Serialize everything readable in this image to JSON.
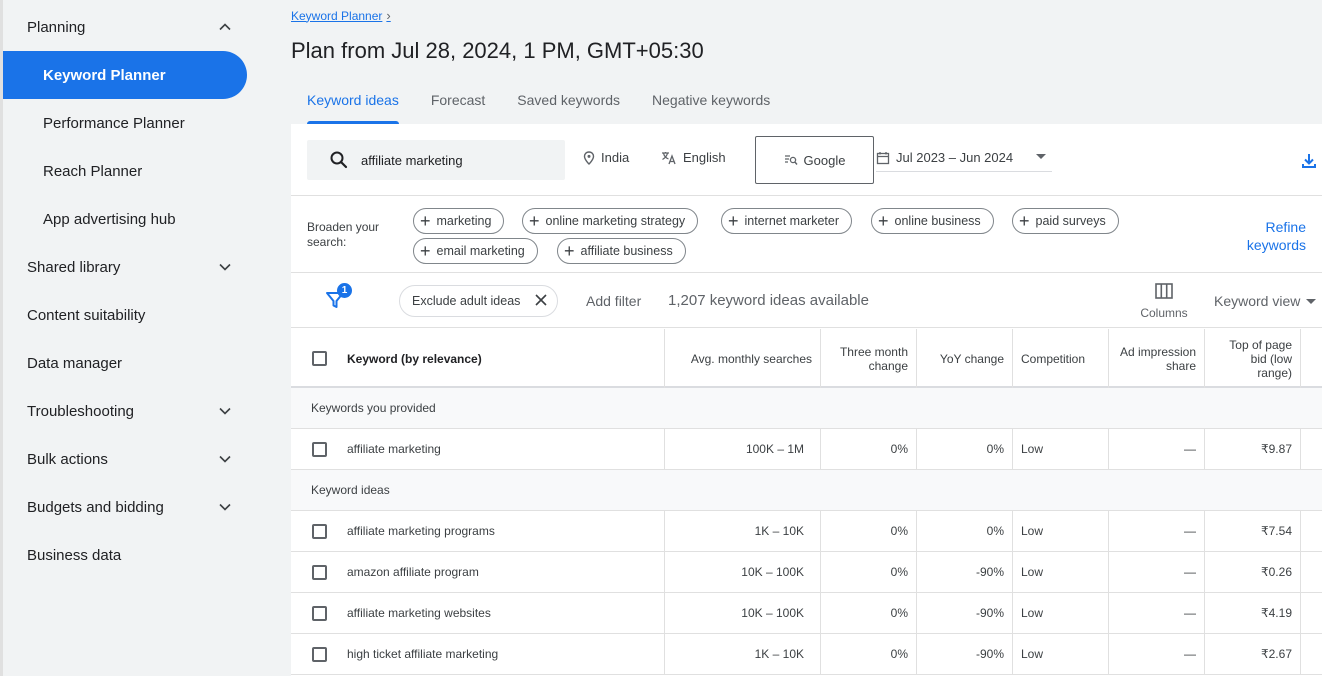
{
  "sidebar": {
    "items": [
      {
        "label": "Planning",
        "expanded": true
      },
      {
        "label": "Keyword Planner",
        "active": true
      },
      {
        "label": "Performance Planner"
      },
      {
        "label": "Reach Planner"
      },
      {
        "label": "App advertising hub"
      },
      {
        "label": "Shared library",
        "expandable": true
      },
      {
        "label": "Content suitability"
      },
      {
        "label": "Data manager"
      },
      {
        "label": "Troubleshooting",
        "expandable": true
      },
      {
        "label": "Bulk actions",
        "expandable": true
      },
      {
        "label": "Budgets and bidding",
        "expandable": true
      },
      {
        "label": "Business data"
      }
    ]
  },
  "header": {
    "breadcrumb": "Keyword Planner",
    "title": "Plan from Jul 28, 2024, 1 PM, GMT+05:30",
    "tabs": [
      {
        "label": "Keyword ideas",
        "active": true
      },
      {
        "label": "Forecast"
      },
      {
        "label": "Saved keywords"
      },
      {
        "label": "Negative keywords"
      }
    ]
  },
  "search": {
    "query": "affiliate marketing",
    "location": "India",
    "language": "English",
    "network": "Google",
    "date_range": "Jul 2023 – Jun 2024"
  },
  "broaden": {
    "label": "Broaden your search:",
    "chips": [
      "marketing",
      "online marketing strategy",
      "internet marketer",
      "online business",
      "paid surveys",
      "email marketing",
      "affiliate business"
    ],
    "refine_line1": "Refine",
    "refine_line2": "keywords"
  },
  "filters": {
    "badge_count": "1",
    "chip_label": "Exclude adult ideas",
    "add_filter": "Add filter",
    "count_text": "1,207 keyword ideas available",
    "columns_label": "Columns",
    "view_label": "Keyword view"
  },
  "table": {
    "headers": {
      "keyword": "Keyword (by relevance)",
      "avg": "Avg. monthly searches",
      "three_l1": "Three month",
      "three_l2": "change",
      "yoy": "YoY change",
      "competition": "Competition",
      "adimp_l1": "Ad impression",
      "adimp_l2": "share",
      "top_l1": "Top of page",
      "top_l2": "bid (low",
      "top_l3": "range)"
    },
    "group_provided": "Keywords you provided",
    "provided_rows": [
      {
        "keyword": "affiliate marketing",
        "avg": "100K – 1M",
        "three": "0%",
        "yoy": "0%",
        "competition": "Low",
        "adimp": "—",
        "bid": "₹9.87"
      }
    ],
    "group_ideas": "Keyword ideas",
    "idea_rows": [
      {
        "keyword": "affiliate marketing programs",
        "avg": "1K – 10K",
        "three": "0%",
        "yoy": "0%",
        "competition": "Low",
        "adimp": "—",
        "bid": "₹7.54"
      },
      {
        "keyword": "amazon affiliate program",
        "avg": "10K – 100K",
        "three": "0%",
        "yoy": "-90%",
        "competition": "Low",
        "adimp": "—",
        "bid": "₹0.26"
      },
      {
        "keyword": "affiliate marketing websites",
        "avg": "10K – 100K",
        "three": "0%",
        "yoy": "-90%",
        "competition": "Low",
        "adimp": "—",
        "bid": "₹4.19"
      },
      {
        "keyword": "high ticket affiliate marketing",
        "avg": "1K – 10K",
        "three": "0%",
        "yoy": "-90%",
        "competition": "Low",
        "adimp": "—",
        "bid": "₹2.67"
      }
    ]
  },
  "colors": {
    "accent": "#1a73e8",
    "text": "#3c4043",
    "border": "#e0e0e0"
  }
}
